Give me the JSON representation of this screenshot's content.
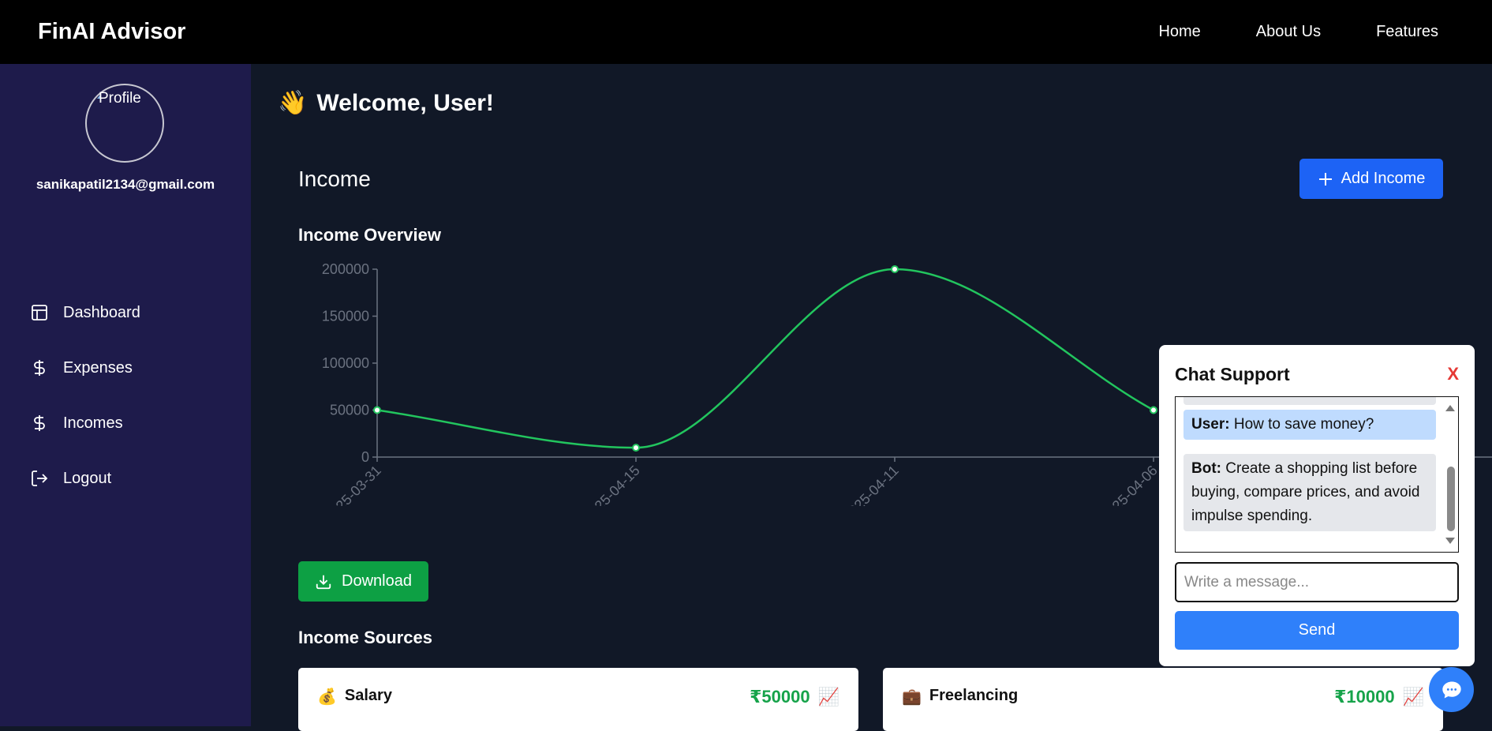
{
  "app": {
    "brand": "FinAI Advisor"
  },
  "topnav": {
    "home": "Home",
    "about": "About Us",
    "features": "Features"
  },
  "sidebar": {
    "avatar_alt": "Profile",
    "email": "sanikapatil2134@gmail.com",
    "items": [
      {
        "label": "Dashboard",
        "icon": "layout-icon"
      },
      {
        "label": "Expenses",
        "icon": "dollar-icon"
      },
      {
        "label": "Incomes",
        "icon": "dollar-icon"
      },
      {
        "label": "Logout",
        "icon": "logout-icon"
      }
    ]
  },
  "main": {
    "welcome_emoji": "👋",
    "welcome": "Welcome, User!",
    "section_title": "Income",
    "add_income_label": "Add Income",
    "overview_title": "Income Overview",
    "download_label": "Download",
    "sources_title": "Income Sources"
  },
  "chart_data": {
    "type": "line",
    "x": [
      "2025-03-31",
      "2025-04-15",
      "2025-04-11",
      "2025-04-06"
    ],
    "series": [
      {
        "values": [
          50000,
          10000,
          200000,
          50000
        ],
        "color": "#22c55e"
      }
    ],
    "ylim": [
      0,
      200000
    ],
    "yticks": [
      "0",
      "50000",
      "100000",
      "150000",
      "200000"
    ],
    "grid": false
  },
  "sources": [
    {
      "emoji": "💰",
      "name": "Salary",
      "amount": "₹50000",
      "trend_icon": "📈"
    },
    {
      "emoji": "💼",
      "name": "Freelancing",
      "amount": "₹10000",
      "trend_icon": "📈"
    }
  ],
  "chat": {
    "title": "Chat Support",
    "close_label": "X",
    "messages": [
      {
        "role": "User:",
        "text": "How to save money?"
      },
      {
        "role": "Bot:",
        "text": "Create a shopping list before buying, compare prices, and avoid impulse spending."
      }
    ],
    "input_placeholder": "Write a message...",
    "send_label": "Send"
  },
  "colors": {
    "accent": "#1d63f5",
    "success": "#0da044",
    "sidebar": "#1e1b4b",
    "line": "#22c55e"
  }
}
